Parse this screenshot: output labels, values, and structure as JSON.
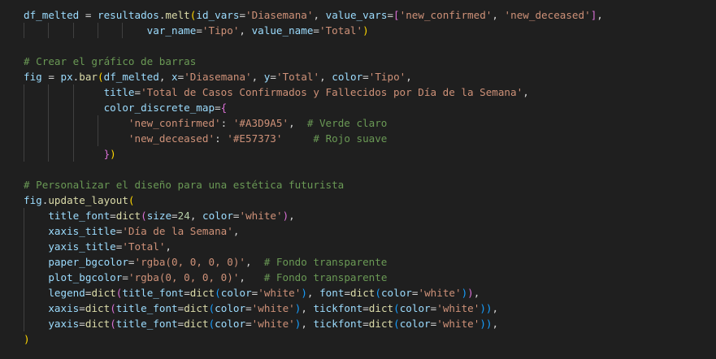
{
  "editor": {
    "theme_colors": {
      "background": "#1f1f1f",
      "variable": "#9cdcfe",
      "function": "#dcdcaa",
      "string": "#ce9178",
      "number": "#b5cea8",
      "comment": "#6a9955",
      "bracket_level1": "#ffd700",
      "bracket_level2": "#da70d6",
      "bracket_level3": "#179fff"
    },
    "lines": [
      [
        [
          "v",
          "df_melted"
        ],
        [
          "o",
          " = "
        ],
        [
          "v",
          "resultados"
        ],
        [
          "o",
          "."
        ],
        [
          "f",
          "melt"
        ],
        [
          "b1",
          "("
        ],
        [
          "v",
          "id_vars"
        ],
        [
          "o",
          "="
        ],
        [
          "s",
          "'Diasemana'"
        ],
        [
          "o",
          ", "
        ],
        [
          "v",
          "value_vars"
        ],
        [
          "o",
          "="
        ],
        [
          "b2",
          "["
        ],
        [
          "s",
          "'new_confirmed'"
        ],
        [
          "o",
          ", "
        ],
        [
          "s",
          "'new_deceased'"
        ],
        [
          "b2",
          "]"
        ],
        [
          "o",
          ","
        ]
      ],
      [
        [
          "o",
          "                    "
        ],
        [
          "v",
          "var_name"
        ],
        [
          "o",
          "="
        ],
        [
          "s",
          "'Tipo'"
        ],
        [
          "o",
          ", "
        ],
        [
          "v",
          "value_name"
        ],
        [
          "o",
          "="
        ],
        [
          "s",
          "'Total'"
        ],
        [
          "b1",
          ")"
        ]
      ],
      [],
      [
        [
          "c",
          "# Crear el gráfico de barras"
        ]
      ],
      [
        [
          "v",
          "fig"
        ],
        [
          "o",
          " = "
        ],
        [
          "v",
          "px"
        ],
        [
          "o",
          "."
        ],
        [
          "f",
          "bar"
        ],
        [
          "b1",
          "("
        ],
        [
          "v",
          "df_melted"
        ],
        [
          "o",
          ", "
        ],
        [
          "v",
          "x"
        ],
        [
          "o",
          "="
        ],
        [
          "s",
          "'Diasemana'"
        ],
        [
          "o",
          ", "
        ],
        [
          "v",
          "y"
        ],
        [
          "o",
          "="
        ],
        [
          "s",
          "'Total'"
        ],
        [
          "o",
          ", "
        ],
        [
          "v",
          "color"
        ],
        [
          "o",
          "="
        ],
        [
          "s",
          "'Tipo'"
        ],
        [
          "o",
          ","
        ]
      ],
      [
        [
          "o",
          "             "
        ],
        [
          "v",
          "title"
        ],
        [
          "o",
          "="
        ],
        [
          "s",
          "'Total de Casos Confirmados y Fallecidos por Día de la Semana'"
        ],
        [
          "o",
          ","
        ]
      ],
      [
        [
          "o",
          "             "
        ],
        [
          "v",
          "color_discrete_map"
        ],
        [
          "o",
          "="
        ],
        [
          "b2",
          "{"
        ]
      ],
      [
        [
          "o",
          "                 "
        ],
        [
          "s",
          "'new_confirmed'"
        ],
        [
          "o",
          ": "
        ],
        [
          "s",
          "'#A3D9A5'"
        ],
        [
          "o",
          ",  "
        ],
        [
          "c",
          "# Verde claro"
        ]
      ],
      [
        [
          "o",
          "                 "
        ],
        [
          "s",
          "'new_deceased'"
        ],
        [
          "o",
          ": "
        ],
        [
          "s",
          "'#E57373'"
        ],
        [
          "o",
          "     "
        ],
        [
          "c",
          "# Rojo suave"
        ]
      ],
      [
        [
          "o",
          "             "
        ],
        [
          "b2",
          "}"
        ],
        [
          "b1",
          ")"
        ]
      ],
      [],
      [
        [
          "c",
          "# Personalizar el diseño para una estética futurista"
        ]
      ],
      [
        [
          "v",
          "fig"
        ],
        [
          "o",
          "."
        ],
        [
          "f",
          "update_layout"
        ],
        [
          "b1",
          "("
        ]
      ],
      [
        [
          "o",
          "    "
        ],
        [
          "v",
          "title_font"
        ],
        [
          "o",
          "="
        ],
        [
          "f",
          "dict"
        ],
        [
          "b2",
          "("
        ],
        [
          "v",
          "size"
        ],
        [
          "o",
          "="
        ],
        [
          "n",
          "24"
        ],
        [
          "o",
          ", "
        ],
        [
          "v",
          "color"
        ],
        [
          "o",
          "="
        ],
        [
          "s",
          "'white'"
        ],
        [
          "b2",
          ")"
        ],
        [
          "o",
          ","
        ]
      ],
      [
        [
          "o",
          "    "
        ],
        [
          "v",
          "xaxis_title"
        ],
        [
          "o",
          "="
        ],
        [
          "s",
          "'Día de la Semana'"
        ],
        [
          "o",
          ","
        ]
      ],
      [
        [
          "o",
          "    "
        ],
        [
          "v",
          "yaxis_title"
        ],
        [
          "o",
          "="
        ],
        [
          "s",
          "'Total'"
        ],
        [
          "o",
          ","
        ]
      ],
      [
        [
          "o",
          "    "
        ],
        [
          "v",
          "paper_bgcolor"
        ],
        [
          "o",
          "="
        ],
        [
          "s",
          "'rgba(0, 0, 0, 0)'"
        ],
        [
          "o",
          ",  "
        ],
        [
          "c",
          "# Fondo transparente"
        ]
      ],
      [
        [
          "o",
          "    "
        ],
        [
          "v",
          "plot_bgcolor"
        ],
        [
          "o",
          "="
        ],
        [
          "s",
          "'rgba(0, 0, 0, 0)'"
        ],
        [
          "o",
          ",   "
        ],
        [
          "c",
          "# Fondo transparente"
        ]
      ],
      [
        [
          "o",
          "    "
        ],
        [
          "v",
          "legend"
        ],
        [
          "o",
          "="
        ],
        [
          "f",
          "dict"
        ],
        [
          "b2",
          "("
        ],
        [
          "v",
          "title_font"
        ],
        [
          "o",
          "="
        ],
        [
          "f",
          "dict"
        ],
        [
          "b3",
          "("
        ],
        [
          "v",
          "color"
        ],
        [
          "o",
          "="
        ],
        [
          "s",
          "'white'"
        ],
        [
          "b3",
          ")"
        ],
        [
          "o",
          ", "
        ],
        [
          "v",
          "font"
        ],
        [
          "o",
          "="
        ],
        [
          "f",
          "dict"
        ],
        [
          "b3",
          "("
        ],
        [
          "v",
          "color"
        ],
        [
          "o",
          "="
        ],
        [
          "s",
          "'white'"
        ],
        [
          "b3",
          ")"
        ],
        [
          "b2",
          ")"
        ],
        [
          "o",
          ","
        ]
      ],
      [
        [
          "o",
          "    "
        ],
        [
          "v",
          "xaxis"
        ],
        [
          "o",
          "="
        ],
        [
          "f",
          "dict"
        ],
        [
          "b2",
          "("
        ],
        [
          "v",
          "title_font"
        ],
        [
          "o",
          "="
        ],
        [
          "f",
          "dict"
        ],
        [
          "b3",
          "("
        ],
        [
          "v",
          "color"
        ],
        [
          "o",
          "="
        ],
        [
          "s",
          "'white'"
        ],
        [
          "b3",
          ")"
        ],
        [
          "o",
          ", "
        ],
        [
          "v",
          "tickfont"
        ],
        [
          "o",
          "="
        ],
        [
          "f",
          "dict"
        ],
        [
          "b3",
          "("
        ],
        [
          "v",
          "color"
        ],
        [
          "o",
          "="
        ],
        [
          "s",
          "'white'"
        ],
        [
          "b3",
          "))"
        ],
        [
          "o",
          ","
        ]
      ],
      [
        [
          "o",
          "    "
        ],
        [
          "v",
          "yaxis"
        ],
        [
          "o",
          "="
        ],
        [
          "f",
          "dict"
        ],
        [
          "b2",
          "("
        ],
        [
          "v",
          "title_font"
        ],
        [
          "o",
          "="
        ],
        [
          "f",
          "dict"
        ],
        [
          "b3",
          "("
        ],
        [
          "v",
          "color"
        ],
        [
          "o",
          "="
        ],
        [
          "s",
          "'white'"
        ],
        [
          "b3",
          ")"
        ],
        [
          "o",
          ", "
        ],
        [
          "v",
          "tickfont"
        ],
        [
          "o",
          "="
        ],
        [
          "f",
          "dict"
        ],
        [
          "b3",
          "("
        ],
        [
          "v",
          "color"
        ],
        [
          "o",
          "="
        ],
        [
          "s",
          "'white'"
        ],
        [
          "b3",
          "))"
        ],
        [
          "o",
          ","
        ]
      ],
      [
        [
          "b1",
          ")"
        ]
      ]
    ]
  }
}
